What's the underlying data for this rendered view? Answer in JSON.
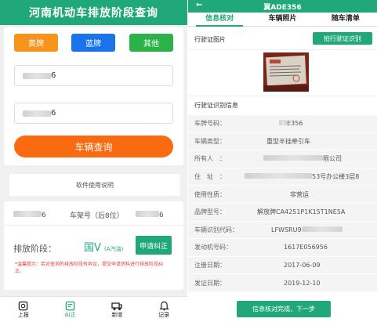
{
  "left": {
    "title": "河南机动车排放阶段查询",
    "plate_types": [
      {
        "label": "黄牌",
        "color": "#f8941c"
      },
      {
        "label": "蓝牌",
        "color": "#1a73e8"
      },
      {
        "label": "其他",
        "color": "#2bb34a"
      }
    ],
    "input1_suffix": "6",
    "input2_suffix": "6",
    "query_button": "车辆查询",
    "help_text": "软件使用说明",
    "result": {
      "plate_suffix": "6",
      "vin_label": "车架号（后8位）",
      "vin_suffix": "6"
    },
    "stage_label": "排放阶段：",
    "stage_value": "国V",
    "stage_sub": "(A汽油)",
    "apply_button": "申请纠正",
    "warning": "*温馨提示：若对查询的排放阶段有异议，提交申请资料进行排放阶段纠正。",
    "nav": [
      {
        "label": "上报",
        "icon": "upload-icon"
      },
      {
        "label": "纠正",
        "icon": "edit-icon"
      },
      {
        "label": "新增",
        "icon": "vehicle-icon"
      },
      {
        "label": "记录",
        "icon": "bell-icon"
      }
    ]
  },
  "right": {
    "title": "冀ADE356",
    "tabs": [
      "信息核对",
      "车辆照片",
      "随车清单"
    ],
    "license_section": "行驶证图片",
    "recognize_button": "拍行驶证识别",
    "info_section": "行驶证识别信息",
    "rows": [
      {
        "k": "车牌号码：",
        "v": "E356"
      },
      {
        "k": "车辆类型：",
        "v": "重型半挂牵引车"
      },
      {
        "k": "所有人　：",
        "v": "限公司"
      },
      {
        "k": "住　址　：",
        "v": "53号办公楼3层8"
      },
      {
        "k": "使用性质：",
        "v": "非营运"
      },
      {
        "k": "品牌型号：",
        "v": "解放牌CA4251P1K15T1NE5A"
      },
      {
        "k": "车辆识别代码：",
        "v": "LFWSRU9"
      },
      {
        "k": "发动机号码：",
        "v": "1617E056956"
      },
      {
        "k": "注册日期：",
        "v": "2017-06-09"
      },
      {
        "k": "发证日期：",
        "v": "2019-12-10"
      }
    ],
    "next_button": "信息核对完成，下一步"
  }
}
